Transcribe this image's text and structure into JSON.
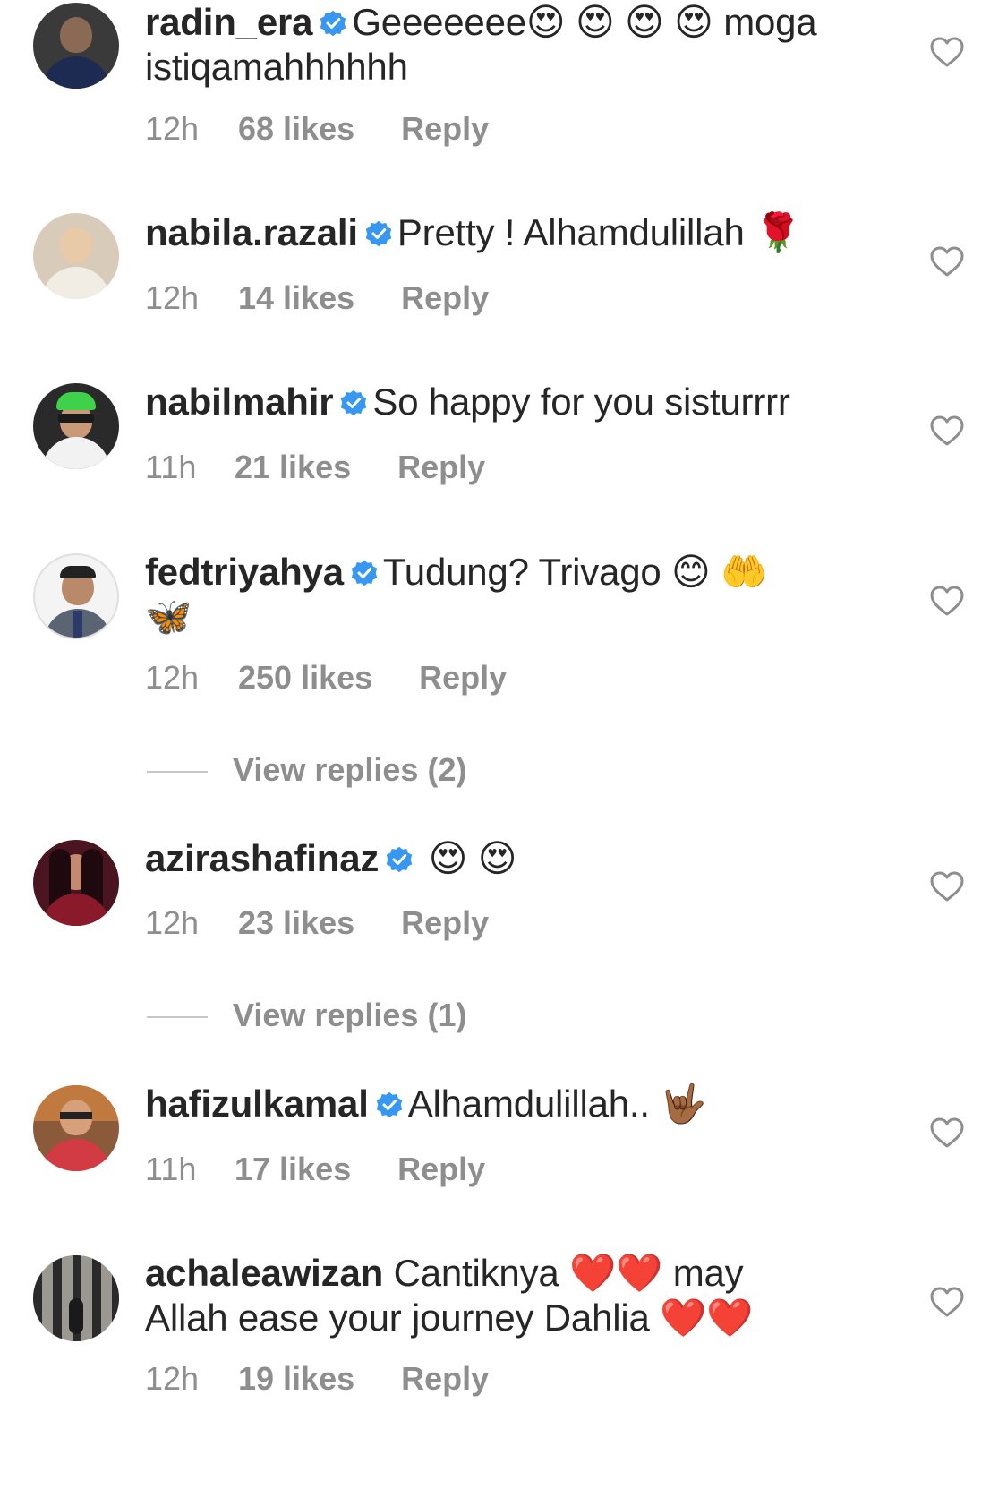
{
  "comments": [
    {
      "username": "radin_era",
      "text_parts": [
        "Geeeeeee",
        "😍",
        "😍",
        "😍",
        "😍",
        "moga",
        "istiqamahhhhhh"
      ],
      "time": "12h",
      "likes": "68 likes",
      "reply": "Reply"
    },
    {
      "username": "nabila.razali",
      "text": "Pretty ! Alhamdulillah",
      "emoji": "🌹",
      "time": "12h",
      "likes": "14 likes",
      "reply": "Reply"
    },
    {
      "username": "nabilmahir",
      "text": "So happy for you sisturrrr",
      "time": "11h",
      "likes": "21 likes",
      "reply": "Reply"
    },
    {
      "username": "fedtriyahya",
      "text": "Tudung? Trivago",
      "emoji1": "😊",
      "emoji2": "🤲",
      "emoji3": "🦋",
      "time": "12h",
      "likes": "250 likes",
      "reply": "Reply",
      "view_replies": "View replies (2)"
    },
    {
      "username": "azirashafinaz",
      "emoji1": "😍",
      "emoji2": "😍",
      "time": "12h",
      "likes": "23 likes",
      "reply": "Reply",
      "view_replies": "View replies (1)"
    },
    {
      "username": "hafizulkamal",
      "text": "Alhamdulillah..",
      "emoji": "🤟🏾",
      "time": "11h",
      "likes": "17 likes",
      "reply": "Reply"
    },
    {
      "username": "achaleawizan",
      "text1": "Cantiknya",
      "emoji1": "❤️",
      "emoji2": "❤️",
      "text2": "may",
      "text3": "Allah ease your journey Dahlia",
      "emoji3": "❤️",
      "emoji4": "❤️",
      "time": "12h",
      "likes": "19 likes",
      "reply": "Reply"
    }
  ],
  "icons": {
    "verified": "verified-badge-icon",
    "like": "heart-outline-icon"
  },
  "colors": {
    "text": "#262626",
    "secondary": "#8e8e8e",
    "verified": "#3897f0",
    "divider": "#c7c7c7"
  }
}
